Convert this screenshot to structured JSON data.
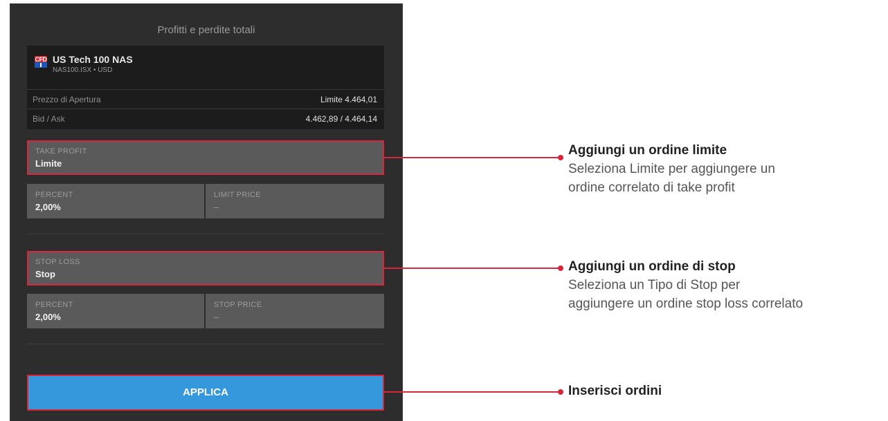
{
  "panel": {
    "title": "Profitti e perdite totali"
  },
  "instrument": {
    "badge": "CFD",
    "name": "US Tech 100 NAS",
    "symbol_line": "NAS100.ISX • USD",
    "rows": [
      {
        "label": "Prezzo di Apertura",
        "value": "Limite 4.464,01"
      },
      {
        "label": "Bid / Ask",
        "value": "4.462,89 / 4.464,14"
      }
    ]
  },
  "take_profit": {
    "label": "TAKE PROFIT",
    "value": "Limite",
    "percent_label": "PERCENT",
    "percent_value": "2,00%",
    "price_label": "LIMIT PRICE",
    "price_value": "–"
  },
  "stop_loss": {
    "label": "STOP LOSS",
    "value": "Stop",
    "percent_label": "PERCENT",
    "percent_value": "2,00%",
    "price_label": "STOP PRICE",
    "price_value": "–"
  },
  "apply_label": "APPLICA",
  "annotations": [
    {
      "title": "Aggiungi un ordine limite",
      "lines": [
        "Seleziona Limite per aggiungere un",
        "ordine correlato di take profit"
      ]
    },
    {
      "title": "Aggiungi un ordine di stop",
      "lines": [
        "Seleziona un Tipo di Stop per",
        "aggiungere un ordine stop loss correlato"
      ]
    },
    {
      "title": "Inserisci ordini",
      "lines": []
    }
  ],
  "colors": {
    "panel_bg": "#2d2d2d",
    "highlight": "#d8263a",
    "apply_bg": "#3598dc"
  }
}
